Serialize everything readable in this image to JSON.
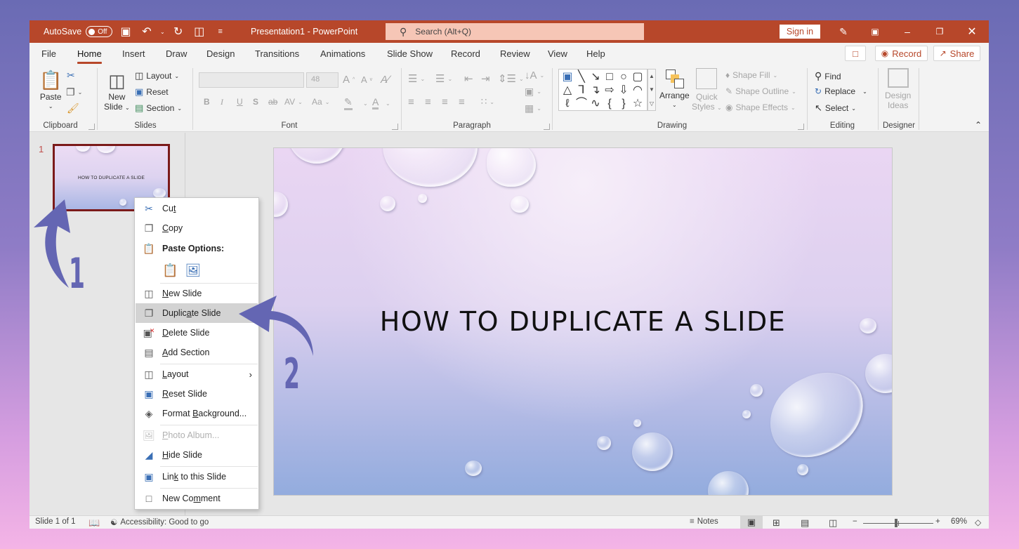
{
  "titlebar": {
    "autosave_label": "AutoSave",
    "autosave_state": "Off",
    "title": "Presentation1  -  PowerPoint",
    "search_placeholder": "Search (Alt+Q)",
    "sign_in": "Sign in",
    "icons": [
      "save-icon",
      "undo-icon",
      "redo-icon",
      "present-icon",
      "customize-icon",
      "pen-icon",
      "ribbon-display-icon",
      "minimize-icon",
      "restore-icon",
      "close-icon"
    ]
  },
  "tabs": [
    {
      "label": "File"
    },
    {
      "label": "Home",
      "active": true
    },
    {
      "label": "Insert"
    },
    {
      "label": "Draw"
    },
    {
      "label": "Design"
    },
    {
      "label": "Transitions"
    },
    {
      "label": "Animations"
    },
    {
      "label": "Slide Show"
    },
    {
      "label": "Record"
    },
    {
      "label": "Review"
    },
    {
      "label": "View"
    },
    {
      "label": "Help"
    }
  ],
  "tab_actions": {
    "record": "Record",
    "share": "Share"
  },
  "ribbon": {
    "clipboard": {
      "label": "Clipboard",
      "paste": "Paste"
    },
    "slides": {
      "label": "Slides",
      "new_slide_1": "New",
      "new_slide_2": "Slide",
      "layout": "Layout",
      "reset": "Reset",
      "section": "Section"
    },
    "font": {
      "label": "Font",
      "font_name": "",
      "font_size": "48",
      "bold": "B",
      "italic": "I",
      "underline": "U",
      "shadow": "S",
      "strike": "ab",
      "spacing": "AV",
      "case": "Aa",
      "color": "A",
      "grow": "A",
      "shrink": "A"
    },
    "paragraph": {
      "label": "Paragraph"
    },
    "drawing": {
      "label": "Drawing",
      "arrange": "Arrange",
      "quick_styles_1": "Quick",
      "quick_styles_2": "Styles",
      "shape_fill": "Shape Fill",
      "shape_outline": "Shape Outline",
      "shape_effects": "Shape Effects",
      "shapes": [
        "▣",
        "╲",
        "↘",
        "□",
        "○",
        "▢",
        "△",
        "⅂",
        "↴",
        "⇨",
        "⇩",
        "◠",
        "ℓ",
        "⌒",
        "∿",
        "{",
        "}",
        "☆"
      ]
    },
    "editing": {
      "label": "Editing",
      "find": "Find",
      "replace": "Replace",
      "select": "Select"
    },
    "designer": {
      "label": "Designer",
      "design_ideas_1": "Design",
      "design_ideas_2": "Ideas"
    }
  },
  "slide_panel": {
    "number": "1",
    "thumb_title": "HOW TO DUPLICATE A SLIDE"
  },
  "slide": {
    "title": "HOW TO DUPLICATE A SLIDE"
  },
  "context_menu": {
    "cut": {
      "pre": "Cu",
      "ul": "t",
      "post": ""
    },
    "copy": {
      "pre": "",
      "ul": "C",
      "post": "opy"
    },
    "paste_options": "Paste Options:",
    "new_slide": {
      "pre": "",
      "ul": "N",
      "post": "ew Slide"
    },
    "duplicate_slide": {
      "pre": "Duplic",
      "ul": "a",
      "post": "te Slide"
    },
    "delete_slide": {
      "pre": "",
      "ul": "D",
      "post": "elete Slide"
    },
    "add_section": {
      "pre": "",
      "ul": "A",
      "post": "dd Section"
    },
    "layout": {
      "pre": "",
      "ul": "L",
      "post": "ayout"
    },
    "reset_slide": {
      "pre": "",
      "ul": "R",
      "post": "eset Slide"
    },
    "format_background": {
      "pre": "Format ",
      "ul": "B",
      "post": "ackground..."
    },
    "photo_album": {
      "pre": "",
      "ul": "P",
      "post": "hoto Album..."
    },
    "hide_slide": {
      "pre": "",
      "ul": "H",
      "post": "ide Slide"
    },
    "link_slide": {
      "pre": "Lin",
      "ul": "k",
      "post": " to this Slide"
    },
    "new_comment": {
      "pre": "New Co",
      "ul": "m",
      "post": "ment"
    },
    "highlighted": "Duplicate Slide"
  },
  "annotations": {
    "step1": "1",
    "step2": "2",
    "color": "#6466b3"
  },
  "statusbar": {
    "slide_count": "Slide 1 of 1",
    "accessibility": "Accessibility: Good to go",
    "notes": "Notes",
    "zoom": "69%"
  }
}
